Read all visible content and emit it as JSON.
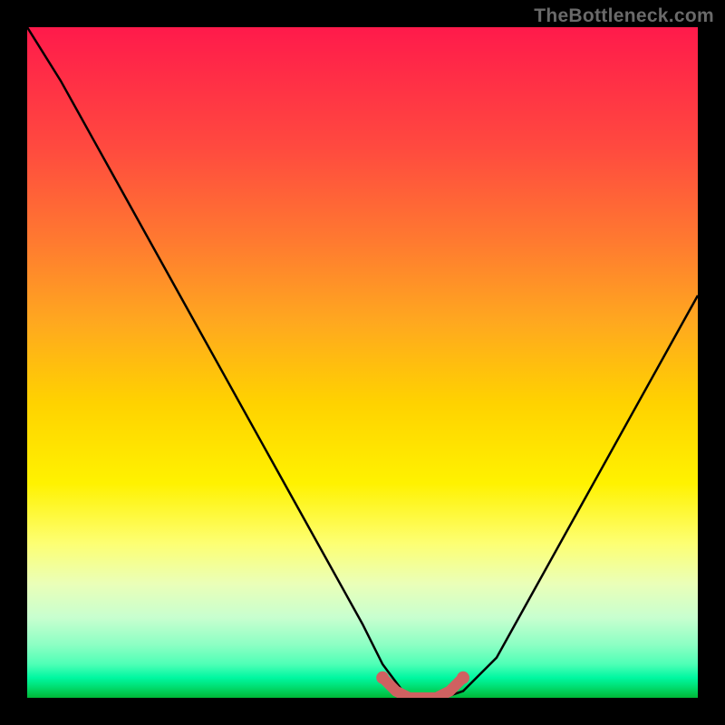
{
  "watermark": "TheBottleneck.com",
  "chart_data": {
    "type": "line",
    "title": "",
    "xlabel": "",
    "ylabel": "",
    "xlim": [
      0,
      100
    ],
    "ylim": [
      0,
      100
    ],
    "series": [
      {
        "name": "bottleneck-curve",
        "x": [
          0,
          5,
          10,
          15,
          20,
          25,
          30,
          35,
          40,
          45,
          50,
          53,
          56,
          59,
          62,
          65,
          70,
          75,
          80,
          85,
          90,
          95,
          100
        ],
        "values": [
          100,
          92,
          83,
          74,
          65,
          56,
          47,
          38,
          29,
          20,
          11,
          5,
          1,
          0,
          0,
          1,
          6,
          15,
          24,
          33,
          42,
          51,
          60
        ]
      },
      {
        "name": "flat-highlight",
        "x": [
          53,
          55,
          57,
          59,
          61,
          63,
          65
        ],
        "values": [
          3,
          1,
          0,
          0,
          0,
          1,
          3
        ]
      }
    ],
    "colors": {
      "curve": "#000000",
      "highlight": "#cf6161"
    }
  }
}
